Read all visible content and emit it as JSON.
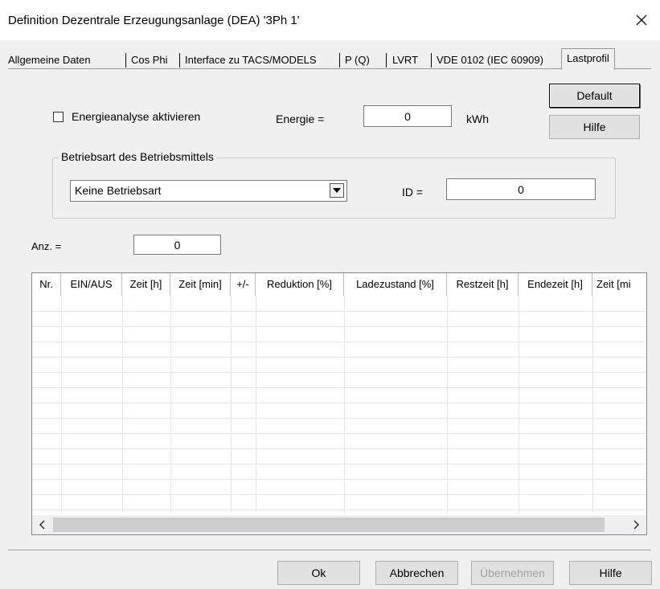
{
  "window": {
    "title": "Definition Dezentrale Erzeugungsanlage (DEA) '3Ph 1'",
    "close_icon": "close-icon"
  },
  "tabs": [
    {
      "label": "Allgemeine Daten",
      "active": false
    },
    {
      "label": "Cos Phi",
      "active": false
    },
    {
      "label": "Interface zu TACS/MODELS",
      "active": false
    },
    {
      "label": "P (Q)",
      "active": false
    },
    {
      "label": "LVRT",
      "active": false
    },
    {
      "label": "VDE 0102 (IEC 60909)",
      "active": false
    },
    {
      "label": "Lastprofil",
      "active": true
    }
  ],
  "side_buttons": {
    "default_label": "Default",
    "help_label": "Hilfe"
  },
  "energy": {
    "checkbox_label": "Energieanalyse aktivieren",
    "checked": false,
    "label": "Energie =",
    "value": "0",
    "unit": "kWh"
  },
  "operation_mode": {
    "group_label": "Betriebsart des Betriebsmittels",
    "selected": "Keine Betriebsart",
    "id_label": "ID =",
    "id_value": "0"
  },
  "count": {
    "label": "Anz. =",
    "value": "0"
  },
  "table": {
    "columns": [
      "Nr.",
      "EIN/AUS",
      "Zeit [h]",
      "Zeit [min]",
      "+/-",
      "Reduktion [%]",
      "Ladezustand [%]",
      "Restzeit [h]",
      "Endezeit [h]",
      "Zeit [mi"
    ],
    "rows": []
  },
  "footer": {
    "ok_label": "Ok",
    "cancel_label": "Abbrechen",
    "apply_label": "Übernehmen",
    "apply_enabled": false,
    "help_label": "Hilfe"
  }
}
